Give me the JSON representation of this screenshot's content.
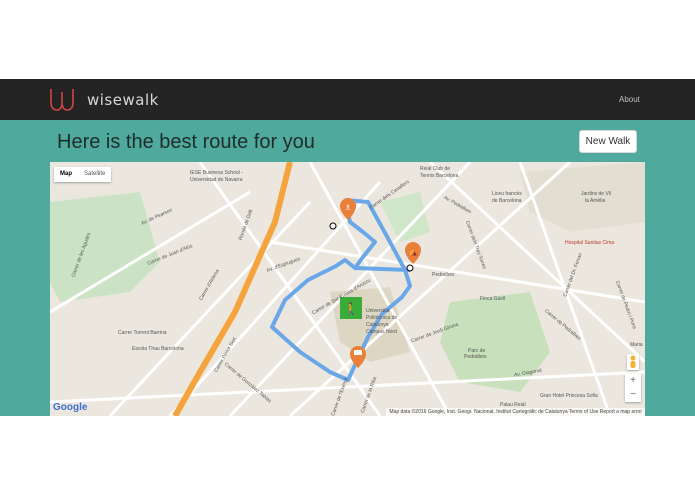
{
  "navbar": {
    "brand": "wisewalk",
    "about": "About"
  },
  "main": {
    "heading": "Here is the best route for you",
    "new_walk_button": "New Walk"
  },
  "map": {
    "type_control": [
      "Map",
      "Satellite"
    ],
    "zoom_in": "+",
    "zoom_out": "−",
    "attribution": "Map data ©2016 Google, Inst. Geogr. Nacional, Institut Cartogràfic de Catalunya   Terms of Use   Report a map error",
    "google": "Google",
    "labels": [
      "IESE Business School -",
      "Universidad de Navarra",
      "Reial Club de",
      "Tennis Barcelona",
      "Liceu francès",
      "de Barcelona",
      "Jardins de Vil",
      "la Amèlia",
      "Hospital Sanitas Cima",
      "Carrer Torrent Barrina",
      "Escola Thau Barcelona",
      "Universitat",
      "Politècnica de",
      "Catalunya",
      "Campus Nord",
      "Finca Güell",
      "Parc de",
      "Pedralbes",
      "Gran Hotel Princesa Sofia",
      "Palau Reial",
      "Av. de Pearson",
      "Carrer de Joan d'Alòs",
      "Av. d'Esplugues",
      "Ronda de Dalt",
      "Carrer de Sor Eulàlia d'Anzizu",
      "Carrer dels Cavallers",
      "Av. Diagonal",
      "Carrer de Jordi Girona",
      "Carrer de Gonzàlez Tablas",
      "Carrer de l'Exèrcit",
      "Carrer de la Riba",
      "Carrer de Pedralbes",
      "Carrer del Dr. Ferran",
      "Av. Pedralbes",
      "Carrer de les Agudes",
      "Carrer d'Aldena",
      "Carrer Pintor Sert",
      "Pedralbes",
      "Carrer dels Tres Torres",
      "Carrer de Pedro i Pons",
      "Maria"
    ]
  },
  "colors": {
    "navbar": "#242424",
    "main_bg": "#4fa99c",
    "route": "#5b9fe5",
    "poi": "#e8803a",
    "start_marker": "#3bab3a",
    "logo": "#d0453f"
  }
}
